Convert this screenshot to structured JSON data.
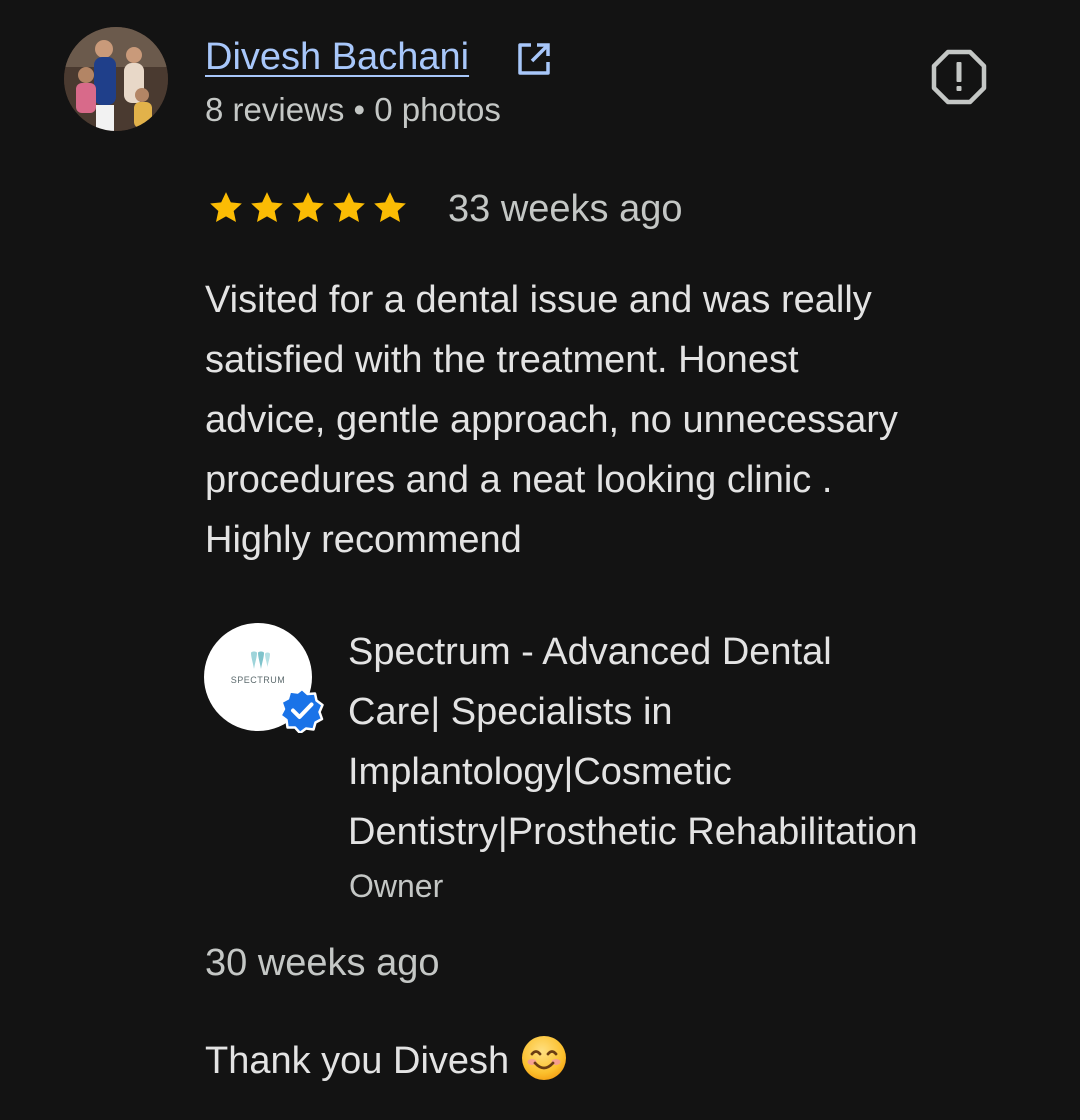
{
  "review": {
    "reviewer": {
      "name": "Divesh Bachani",
      "meta": "8 reviews • 0 photos",
      "avatar_icon": "user-photo"
    },
    "rating": 5,
    "rating_max": 5,
    "star_color": "#fbbc04",
    "age": "33 weeks ago",
    "text": "Visited for a dental issue and was really\nsatisfied with the treatment. Honest\nadvice, gentle approach, no unnecessary\nprocedures and a neat looking clinic .\nHighly recommend"
  },
  "owner_response": {
    "business_name": "Spectrum - Advanced Dental\nCare| Specialists in\nImplantology|Cosmetic\nDentistry|Prosthetic Rehabilitation",
    "logo_text": "SPECTRUM",
    "role": "Owner",
    "age": "30 weeks ago",
    "text": "Thank you Divesh",
    "emoji": "smiling-face-icon"
  },
  "colors": {
    "background": "#131313",
    "link": "#a8c7fa",
    "secondary_text": "#c4c7c5",
    "primary_text": "#e3e3e3",
    "verified": "#1a73e8"
  }
}
